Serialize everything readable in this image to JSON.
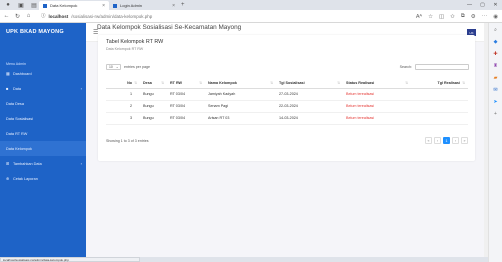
{
  "browser": {
    "tabs": [
      {
        "label": "Data Kelompok",
        "active": true
      },
      {
        "label": "Login Admin",
        "active": false
      }
    ],
    "new_tab": "+",
    "url_host": "localhost",
    "url_path": "/sosialisasi-rw/admin/data-kelompok.php",
    "status_url": "localhost/sosialisasi-rw/admin/data-kelompok.php"
  },
  "sidebar": {
    "brand": "UPK BKAD MAYONG",
    "menu_heading": "Menu Admin",
    "items": [
      {
        "label": "Dashboard",
        "icon": "grid-icon"
      },
      {
        "label": "Data",
        "icon": "folder-icon",
        "chevron": "›"
      },
      {
        "label": "Data Desa"
      },
      {
        "label": "Data Sosialisasi"
      },
      {
        "label": "Data RT RW"
      },
      {
        "label": "Data Kelompok",
        "active": true
      },
      {
        "label": "Tambahkan Data",
        "icon": "plus-square-icon",
        "chevron": "›"
      },
      {
        "label": "Cetak Laporan",
        "icon": "print-icon"
      }
    ]
  },
  "topbar": {
    "menu_icon": "☰",
    "flag": "UK"
  },
  "page": {
    "title": "Data Kelompok Sosialisasi Se-Kecamatan Mayong"
  },
  "card": {
    "title": "Tabel Kelompok RT RW",
    "subtitle": "Data Kelompok RT RW",
    "length_value": "10",
    "length_caret": "⌄",
    "length_suffix": "entries per page",
    "search_label": "Search:",
    "columns": [
      "No",
      "Desa",
      "RT RW",
      "Nama Kelompok",
      "Tgl Sosialisasi",
      "Status Realisasi",
      "Tgl Realisasi"
    ],
    "rows": [
      [
        "1",
        "Bungu",
        "RT 03/04",
        "Jamiyah Kadyah",
        "27-03-2024",
        "Belum terealisasi",
        ""
      ],
      [
        "2",
        "Bungu",
        "RT 03/04",
        "Senam Pagi",
        "22-03-2024",
        "Belum terealisasi",
        ""
      ],
      [
        "3",
        "Bungu",
        "RT 03/04",
        "Arisan RT 03",
        "14-03-2024",
        "Belum terealisasi",
        ""
      ]
    ],
    "info": "Showing 1 to 3 of 3 entries",
    "pager": [
      "«",
      "‹",
      "1",
      "›",
      "»"
    ]
  },
  "colors": {
    "sidebar": "#1e63c7",
    "status": "#e53935",
    "page_active": "#1e90ff"
  }
}
